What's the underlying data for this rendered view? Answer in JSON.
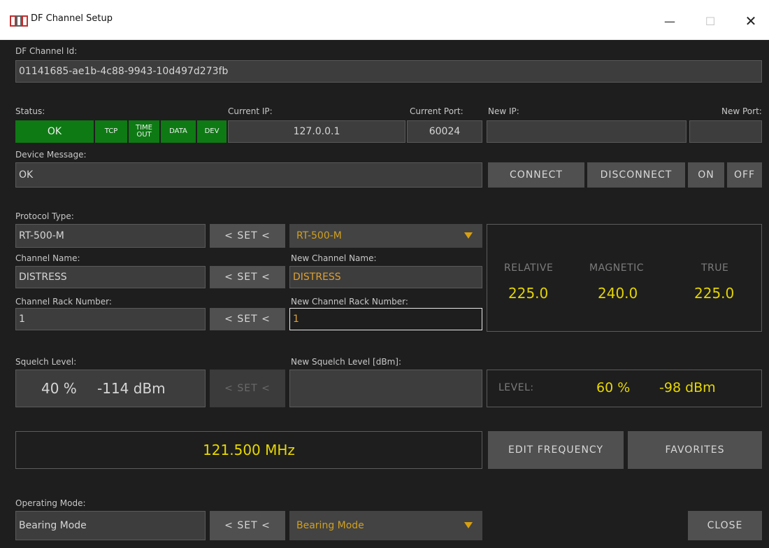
{
  "window": {
    "title": "DF Channel Setup",
    "min": "—",
    "max": "☐",
    "close": "✕"
  },
  "channel_id": {
    "label": "DF Channel Id:",
    "value": "01141685-ae1b-4c88-9943-10d497d273fb"
  },
  "status": {
    "label": "Status:",
    "ok": "OK",
    "tcp": "TCP",
    "timeout": "TIME OUT",
    "data": "DATA",
    "dev": "DEV",
    "color": "#0e7a14"
  },
  "connection": {
    "current_ip_label": "Current IP:",
    "current_ip": "127.0.0.1",
    "current_port_label": "Current Port:",
    "current_port": "60024",
    "new_ip_label": "New IP:",
    "new_ip": "",
    "new_port_label": "New Port:",
    "new_port": ""
  },
  "device_message": {
    "label": "Device Message:",
    "value": "OK"
  },
  "buttons": {
    "connect": "CONNECT",
    "disconnect": "DISCONNECT",
    "on": "ON",
    "off": "OFF",
    "set": "< SET <"
  },
  "protocol": {
    "label": "Protocol Type:",
    "value": "RT-500-M",
    "selected": "RT-500-M"
  },
  "channel_name": {
    "label": "Channel Name:",
    "value": "DISTRESS",
    "new_label": "New Channel Name:",
    "new_value": "DISTRESS"
  },
  "rack": {
    "label": "Channel Rack Number:",
    "value": "1",
    "new_label": "New Channel Rack Number:",
    "new_value": "1"
  },
  "bearing": {
    "relative_label": "RELATIVE",
    "relative": "225.0",
    "magnetic_label": "MAGNETIC",
    "magnetic": "240.0",
    "true_label": "TRUE",
    "true": "225.0"
  },
  "squelch": {
    "label": "Squelch Level:",
    "percent": "40 %",
    "dbm": "-114 dBm",
    "new_label": "New Squelch Level [dBm]:",
    "new_value": ""
  },
  "level": {
    "label": "LEVEL:",
    "percent": "60 %",
    "dbm": "-98 dBm"
  },
  "frequency": {
    "value": "121.500 MHz",
    "edit": "EDIT FREQUENCY",
    "favorites": "FAVORITES"
  },
  "operating_mode": {
    "label": "Operating Mode:",
    "value": "Bearing Mode",
    "selected": "Bearing Mode"
  },
  "close": "CLOSE",
  "colors": {
    "accent_yellow": "#e4d400",
    "accent_orange": "#e0a030",
    "ok_green": "#0e7a14"
  }
}
